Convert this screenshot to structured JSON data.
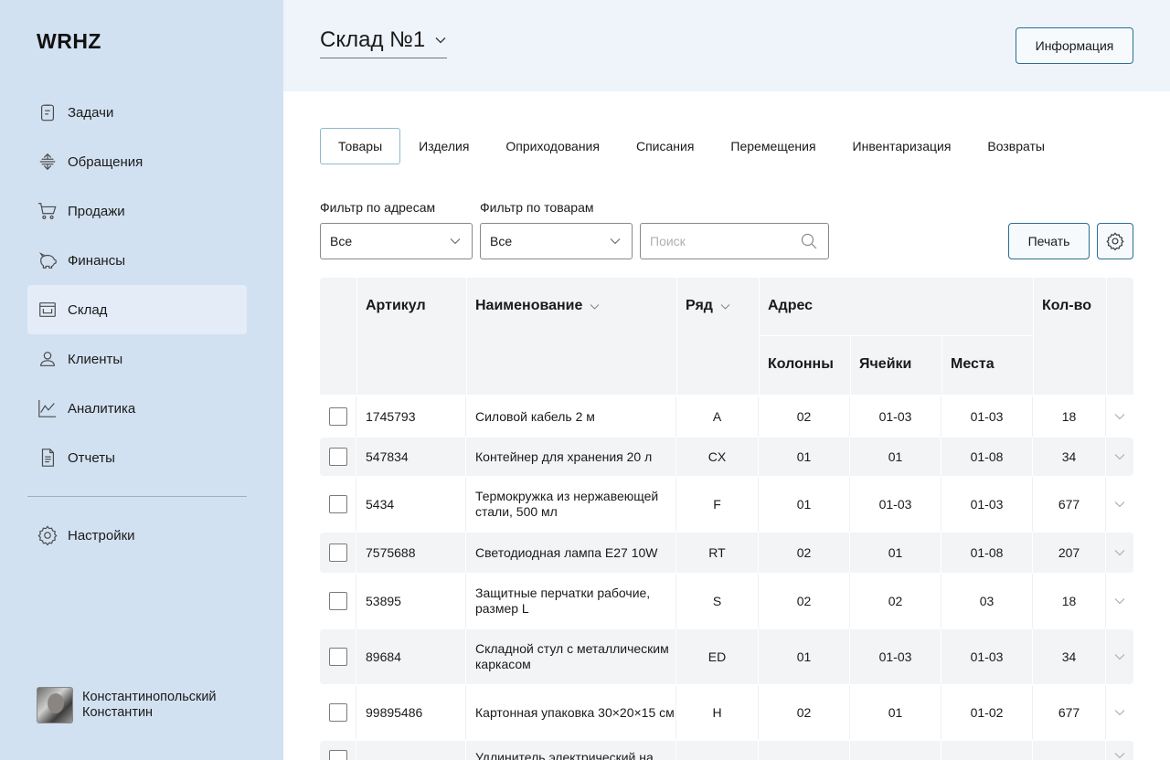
{
  "sidebar": {
    "logo": "WRHZ",
    "items": [
      {
        "label": "Задачи",
        "icon": "clipboard-icon"
      },
      {
        "label": "Обращения",
        "icon": "arrows-icon"
      },
      {
        "label": "Продажи",
        "icon": "cart-icon"
      },
      {
        "label": "Финансы",
        "icon": "piggy-bank-icon"
      },
      {
        "label": "Склад",
        "icon": "warehouse-icon",
        "active": true
      },
      {
        "label": "Клиенты",
        "icon": "person-icon"
      },
      {
        "label": "Аналитика",
        "icon": "chart-icon"
      },
      {
        "label": "Отчеты",
        "icon": "document-icon"
      }
    ],
    "settings": {
      "label": "Настройки",
      "icon": "gear-icon"
    },
    "user": {
      "line1": "Константинопольский",
      "line2": "Константин"
    }
  },
  "header": {
    "warehouse": "Склад №1",
    "info_label": "Информация"
  },
  "tabs": [
    {
      "label": "Товары",
      "active": true
    },
    {
      "label": "Изделия"
    },
    {
      "label": "Оприходования"
    },
    {
      "label": "Списания"
    },
    {
      "label": "Перемещения"
    },
    {
      "label": "Инвентаризация"
    },
    {
      "label": "Возвраты"
    }
  ],
  "filters": {
    "address_label": "Фильтр по адресам",
    "address_value": "Все",
    "goods_label": "Фильтр по товарам",
    "goods_value": "Все",
    "search_placeholder": "Поиск",
    "print_label": "Печать"
  },
  "table": {
    "headers": {
      "article": "Артикул",
      "name": "Наименование",
      "row": "Ряд",
      "address": "Адрес",
      "columns": "Колонны",
      "cells": "Ячейки",
      "places": "Места",
      "qty": "Кол-во"
    },
    "rows": [
      {
        "article": "1745793",
        "name": "Силовой кабель 2 м",
        "row": "A",
        "col": "02",
        "cell": "01-03",
        "place": "01-03",
        "qty": "18"
      },
      {
        "article": "547834",
        "name": "Контейнер для хранения 20 л",
        "row": "CX",
        "col": "01",
        "cell": "01",
        "place": "01-08",
        "qty": "34"
      },
      {
        "article": "5434",
        "name": "Термокружка из нержавеющей стали, 500 мл",
        "row": "F",
        "col": "01",
        "cell": "01-03",
        "place": "01-03",
        "qty": "677"
      },
      {
        "article": "7575688",
        "name": "Светодиодная лампа E27 10W",
        "row": "RT",
        "col": "02",
        "cell": "01",
        "place": "01-08",
        "qty": "207"
      },
      {
        "article": "53895",
        "name": "Защитные перчатки рабочие, размер L",
        "row": "S",
        "col": "02",
        "cell": "02",
        "place": "03",
        "qty": "18"
      },
      {
        "article": "89684",
        "name": "Складной стул с металлическим каркасом",
        "row": "ED",
        "col": "01",
        "cell": "01-03",
        "place": "01-03",
        "qty": "34"
      },
      {
        "article": "99895486",
        "name": "Картонная упаковка 30×20×15 см",
        "row": "H",
        "col": "02",
        "cell": "01",
        "place": "01-02",
        "qty": "677"
      },
      {
        "article": "",
        "name": "Удлинитель электрический на",
        "row": "",
        "col": "",
        "cell": "",
        "place": "",
        "qty": ""
      }
    ]
  }
}
